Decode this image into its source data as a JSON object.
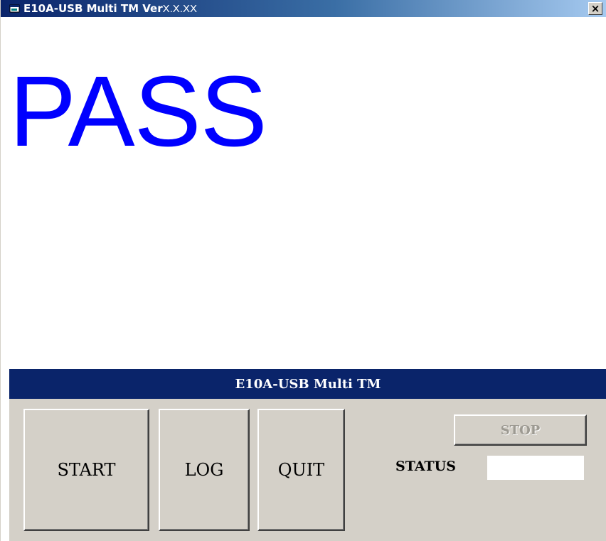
{
  "window": {
    "title": "E10A-USB Multi TM Ver",
    "version": "X.X.XX",
    "close_label": "×"
  },
  "result": {
    "text": "PASS",
    "color": "#0000ff"
  },
  "banner": {
    "text": "E10A-USB Multi TM"
  },
  "controls": {
    "start_label": "START",
    "log_label": "LOG",
    "quit_label": "QUIT",
    "stop_label": "STOP",
    "status_label": "STATUS",
    "status_value": ""
  },
  "colors": {
    "titlebar_start": "#0a246a",
    "titlebar_end": "#a6caf0",
    "banner": "#0a246a",
    "panel": "#d4d0c8"
  },
  "icons": {
    "app": "app-window-icon",
    "close": "close-icon"
  }
}
